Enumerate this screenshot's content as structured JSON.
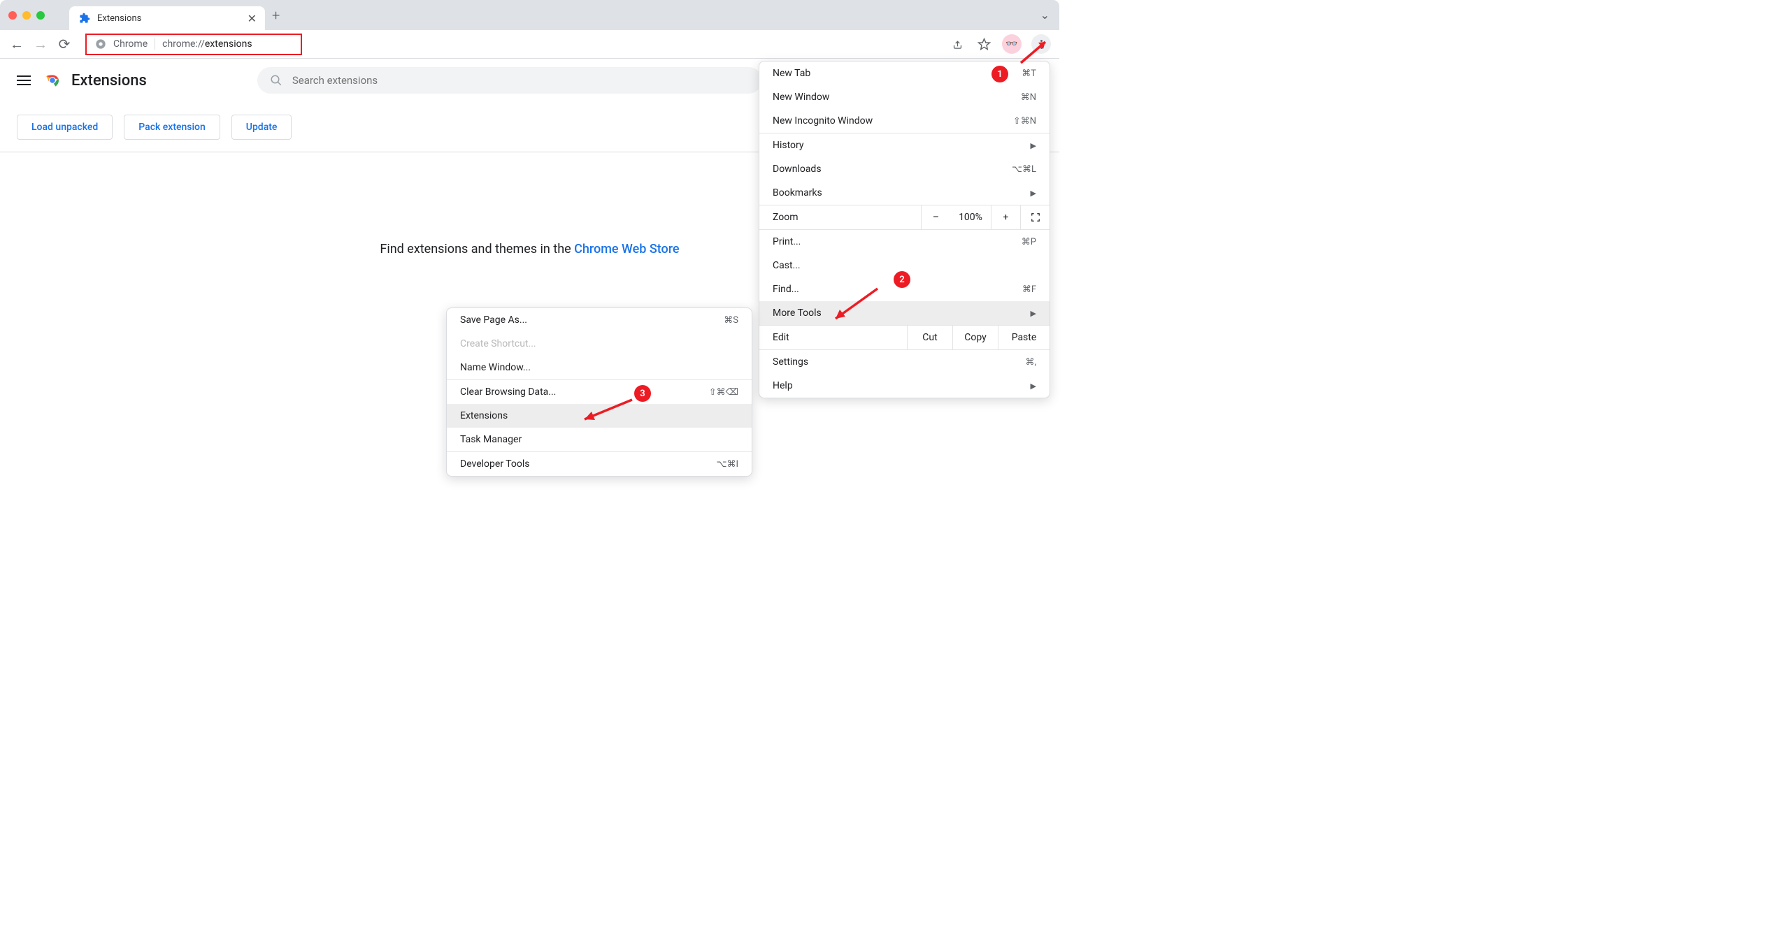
{
  "tab": {
    "title": "Extensions"
  },
  "omnibox": {
    "label": "Chrome",
    "url_prefix": "chrome://",
    "url_suffix": "extensions"
  },
  "ext_header": {
    "title": "Extensions",
    "search_placeholder": "Search extensions"
  },
  "actions": {
    "load": "Load unpacked",
    "pack": "Pack extension",
    "update": "Update"
  },
  "main": {
    "prompt_prefix": "Find extensions and themes in the ",
    "link": "Chrome Web Store"
  },
  "menu_primary": [
    {
      "label": "New Tab",
      "shortcut": "⌘T"
    },
    {
      "label": "New Window",
      "shortcut": "⌘N"
    },
    {
      "label": "New Incognito Window",
      "shortcut": "⇧⌘N"
    },
    {
      "sep": true
    },
    {
      "label": "History",
      "submenu": true
    },
    {
      "label": "Downloads",
      "shortcut": "⌥⌘L"
    },
    {
      "label": "Bookmarks",
      "submenu": true
    },
    {
      "zoom": true,
      "label": "Zoom",
      "minus": "–",
      "pct": "100%",
      "plus": "+"
    },
    {
      "label": "Print...",
      "shortcut": "⌘P"
    },
    {
      "label": "Cast..."
    },
    {
      "label": "Find...",
      "shortcut": "⌘F"
    },
    {
      "label": "More Tools",
      "submenu": true,
      "hover": true
    },
    {
      "edit": true,
      "label": "Edit",
      "cut": "Cut",
      "copy": "Copy",
      "paste": "Paste"
    },
    {
      "label": "Settings",
      "shortcut": "⌘,"
    },
    {
      "label": "Help",
      "submenu": true
    }
  ],
  "menu_sub": [
    {
      "label": "Save Page As...",
      "shortcut": "⌘S"
    },
    {
      "label": "Create Shortcut...",
      "disabled": true
    },
    {
      "label": "Name Window..."
    },
    {
      "sep": true
    },
    {
      "label": "Clear Browsing Data...",
      "shortcut": "⇧⌘⌫"
    },
    {
      "label": "Extensions",
      "hover": true
    },
    {
      "label": "Task Manager"
    },
    {
      "sep": true
    },
    {
      "label": "Developer Tools",
      "shortcut": "⌥⌘I"
    }
  ],
  "annotations": {
    "a1": "1",
    "a2": "2",
    "a3": "3"
  }
}
